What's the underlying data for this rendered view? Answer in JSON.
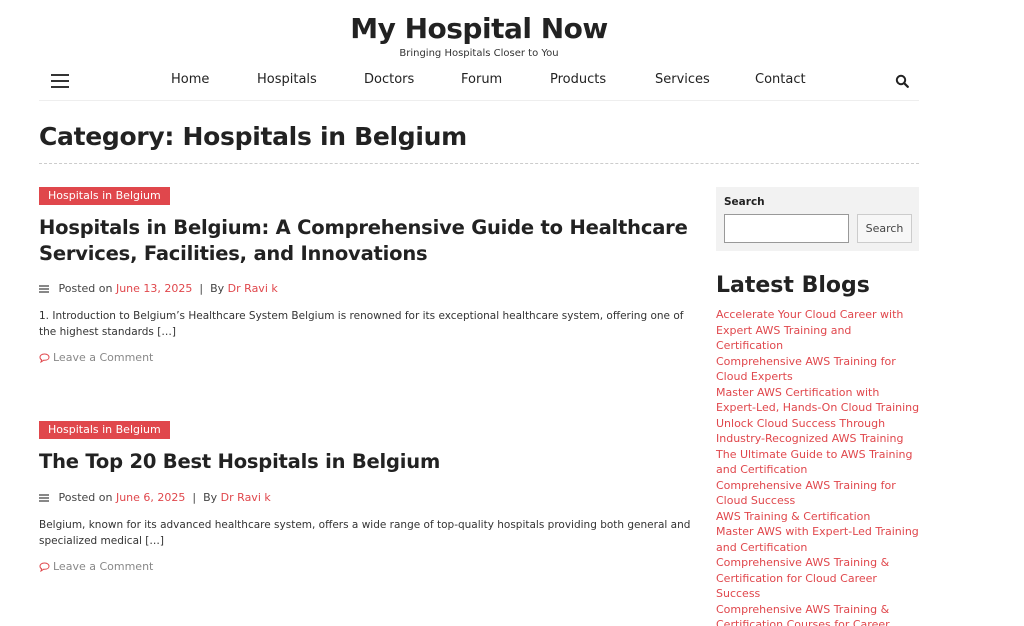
{
  "header": {
    "site_title": "My Hospital Now",
    "tagline": "Bringing Hospitals Closer to You"
  },
  "nav": {
    "items": [
      "Home",
      "Hospitals",
      "Doctors",
      "Forum",
      "Products",
      "Services",
      "Contact"
    ]
  },
  "page": {
    "title": "Category: Hospitals in Belgium"
  },
  "posts": [
    {
      "category": "Hospitals in Belgium",
      "title": "Hospitals in Belgium: A Comprehensive Guide to Healthcare Services, Facilities, and Innovations",
      "posted_on_label": "Posted on",
      "date": "June 13, 2025",
      "by_label": "By",
      "author": "Dr Ravi k",
      "excerpt": "1. Introduction to Belgium’s Healthcare System Belgium is renowned for its exceptional healthcare system, offering one of the highest standards […]",
      "comment_link": "Leave a Comment"
    },
    {
      "category": "Hospitals in Belgium",
      "title": "The Top 20 Best Hospitals in Belgium",
      "posted_on_label": "Posted on",
      "date": "June 6, 2025",
      "by_label": "By",
      "author": "Dr Ravi k",
      "excerpt": "Belgium, known for its advanced healthcare system, offers a wide range of top-quality hospitals providing both general and specialized medical […]",
      "comment_link": "Leave a Comment"
    }
  ],
  "sidebar": {
    "search": {
      "label": "Search",
      "placeholder": "",
      "button_label": "Search"
    },
    "latest_blogs": {
      "title": "Latest Blogs",
      "items": [
        "Accelerate Your Cloud Career with Expert AWS Training and Certification",
        "Comprehensive AWS Training for Cloud Experts",
        "Master AWS Certification with Expert-Led, Hands-On Cloud Training",
        "Unlock Cloud Success Through Industry-Recognized AWS Training",
        "The Ultimate Guide to AWS Training and Certification",
        "Comprehensive AWS Training for Cloud Success",
        "AWS Training & Certification",
        "Master AWS with Expert-Led Training and Certification",
        "Comprehensive AWS Training & Certification for Cloud Career Success",
        "Comprehensive AWS Training & Certification Courses for Career Growth"
      ]
    }
  },
  "colors": {
    "accent": "#e0474c",
    "text": "#222222",
    "sidebar_bg": "#f2f2f2"
  },
  "icons": [
    "menu-icon",
    "search-icon",
    "list-lines-icon",
    "comment-icon"
  ]
}
